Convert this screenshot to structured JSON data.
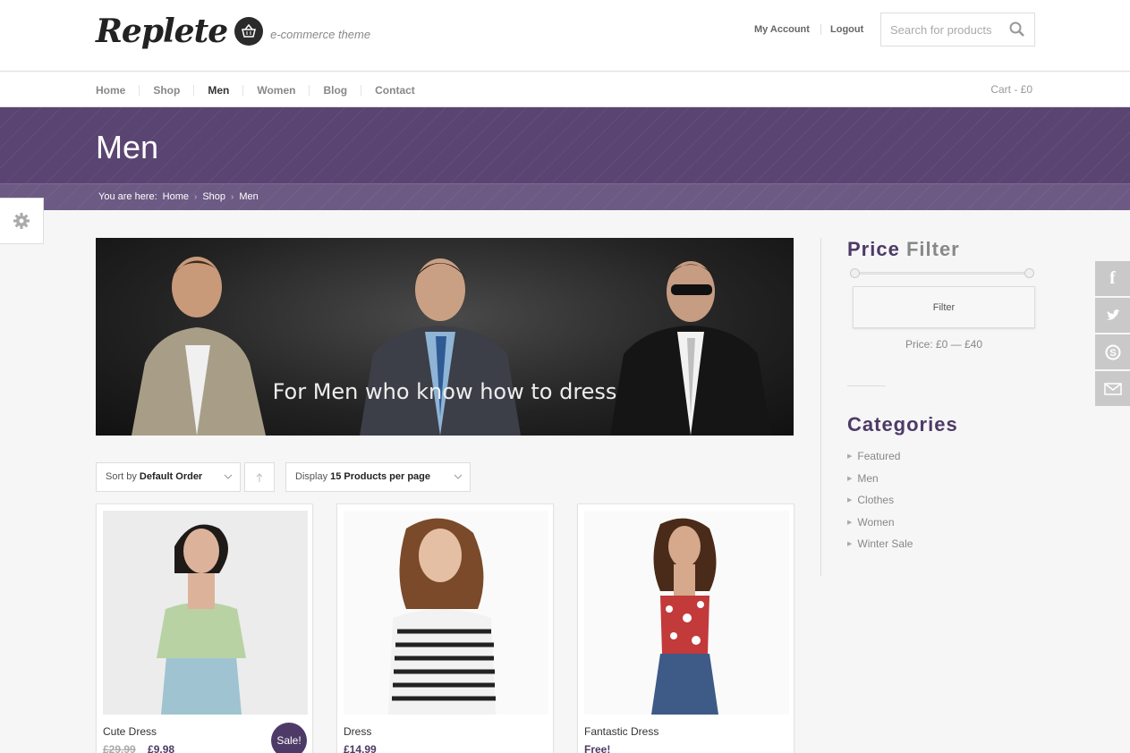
{
  "header": {
    "logo_text": "Replete",
    "logo_tagline": "e-commerce theme",
    "my_account": "My Account",
    "logout": "Logout",
    "search_placeholder": "Search for products"
  },
  "nav": {
    "items": [
      "Home",
      "Shop",
      "Men",
      "Women",
      "Blog",
      "Contact"
    ],
    "active": "Men",
    "cart": "Cart - £0"
  },
  "page": {
    "title": "Men",
    "breadcrumb_label": "You are here:",
    "breadcrumb": [
      "Home",
      "Shop",
      "Men"
    ]
  },
  "hero": {
    "caption": "For Men who know how to dress"
  },
  "sorting": {
    "sort_prefix": "Sort by",
    "sort_value": "Default Order",
    "display_prefix": "Display",
    "display_value": "15 Products per page"
  },
  "products": [
    {
      "name": "Cute Dress",
      "old_price": "£29.99",
      "price": "£9.98",
      "badge": "Sale!"
    },
    {
      "name": "Dress",
      "price": "£14.99"
    },
    {
      "name": "Fantastic Dress",
      "price": "Free!"
    }
  ],
  "sidebar": {
    "price_filter_title_1": "Price",
    "price_filter_title_2": "Filter",
    "filter_button": "Filter",
    "price_range": "Price: £0 — £40",
    "categories_title": "Categories",
    "categories": [
      "Featured",
      "Men",
      "Clothes",
      "Women",
      "Winter Sale"
    ]
  },
  "social": [
    "facebook-icon",
    "twitter-icon",
    "skype-icon",
    "email-icon"
  ],
  "colors": {
    "accent": "#5a4572",
    "accent_dark": "#4d3a66"
  }
}
